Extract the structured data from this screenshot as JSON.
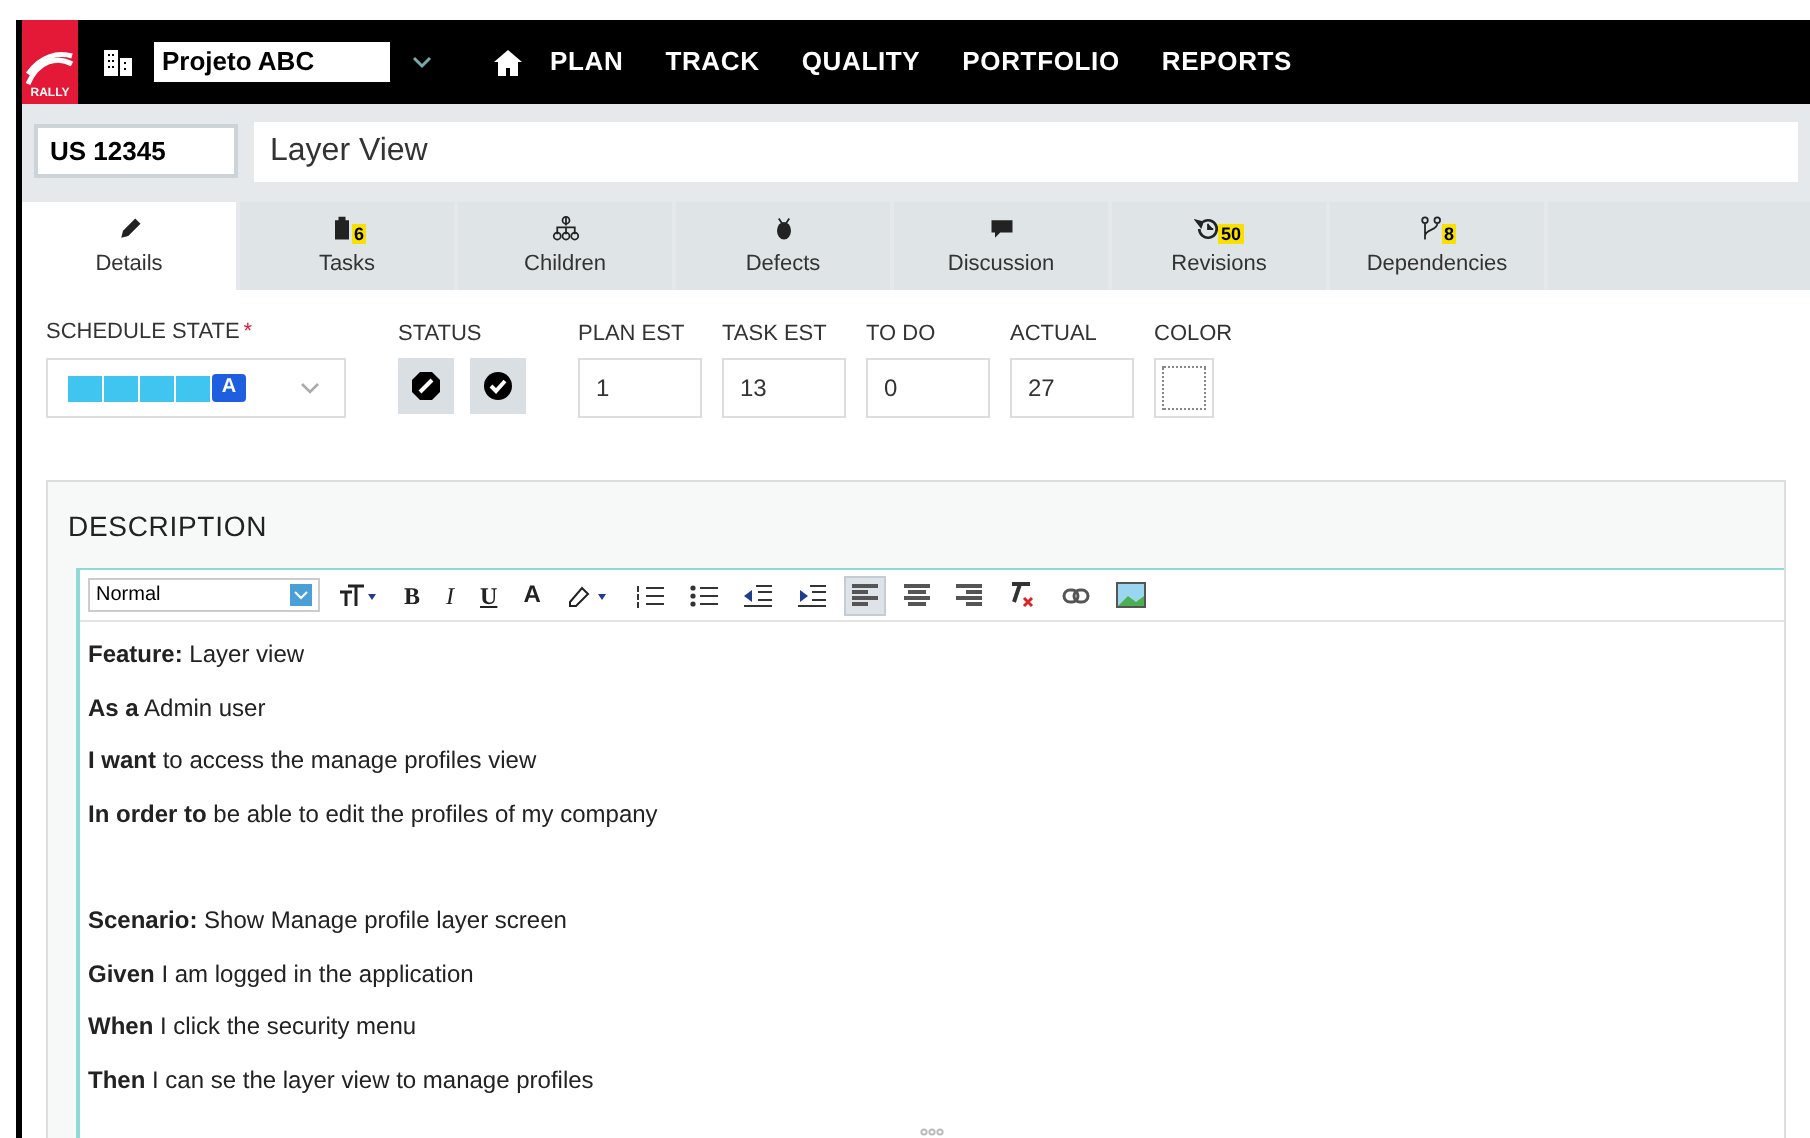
{
  "header": {
    "logo": "RALLY",
    "project": "Projeto ABC",
    "nav": [
      "PLAN",
      "TRACK",
      "QUALITY",
      "PORTFOLIO",
      "REPORTS"
    ]
  },
  "artifact": {
    "id": "US 12345",
    "name": "Layer View"
  },
  "tabs": [
    {
      "label": "Details",
      "kind": "pencil",
      "selected": true
    },
    {
      "label": "Tasks",
      "kind": "clipboard",
      "badge": "6",
      "selected": false
    },
    {
      "label": "Children",
      "kind": "hierarchy",
      "selected": false
    },
    {
      "label": "Defects",
      "kind": "bug",
      "selected": false
    },
    {
      "label": "Discussion",
      "kind": "chat",
      "selected": false
    },
    {
      "label": "Revisions",
      "kind": "history",
      "badge": "50",
      "selected": false
    },
    {
      "label": "Dependencies",
      "kind": "branch",
      "badge": "8",
      "selected": false
    }
  ],
  "fields": {
    "schedule_state": {
      "label": "SCHEDULE STATE",
      "required_mark": "*",
      "value": "A"
    },
    "status": {
      "label": "STATUS"
    },
    "numbers": [
      {
        "label": "PLAN EST",
        "value": "1"
      },
      {
        "label": "TASK EST",
        "value": "13"
      },
      {
        "label": "TO DO",
        "value": "0"
      },
      {
        "label": "ACTUAL",
        "value": "27"
      }
    ],
    "color": {
      "label": "COLOR"
    }
  },
  "description": {
    "title": "DESCRIPTION",
    "format": "Normal",
    "toolbar": [
      {
        "kind": "fontsize",
        "active": false
      },
      {
        "kind": "bold",
        "label": "B",
        "active": false
      },
      {
        "kind": "italic",
        "label": "I",
        "active": false
      },
      {
        "kind": "underline",
        "label": "U",
        "active": false
      },
      {
        "kind": "fontcolor",
        "label": "A",
        "active": false
      },
      {
        "kind": "highlight",
        "active": false
      },
      {
        "kind": "ol",
        "active": false
      },
      {
        "kind": "ul",
        "active": false
      },
      {
        "kind": "outdent",
        "active": false
      },
      {
        "kind": "indent",
        "active": false
      },
      {
        "kind": "alignleft",
        "active": true
      },
      {
        "kind": "aligncenter",
        "active": false
      },
      {
        "kind": "alignright",
        "active": false
      },
      {
        "kind": "clear",
        "active": false
      },
      {
        "kind": "link",
        "active": false
      },
      {
        "kind": "image",
        "active": false
      }
    ],
    "paragraphs": [
      [
        "**Feature:** Layer view",
        "**As a** Admin user",
        "**I want** to access the manage profiles view",
        "**In order to** be able to edit the profiles of my company"
      ],
      [
        "**Scenario:** Show Manage profile layer screen",
        "**Given** I am logged in  the application",
        "**When** I click the security menu",
        "**Then** I can se the layer view to manage profiles"
      ]
    ]
  }
}
